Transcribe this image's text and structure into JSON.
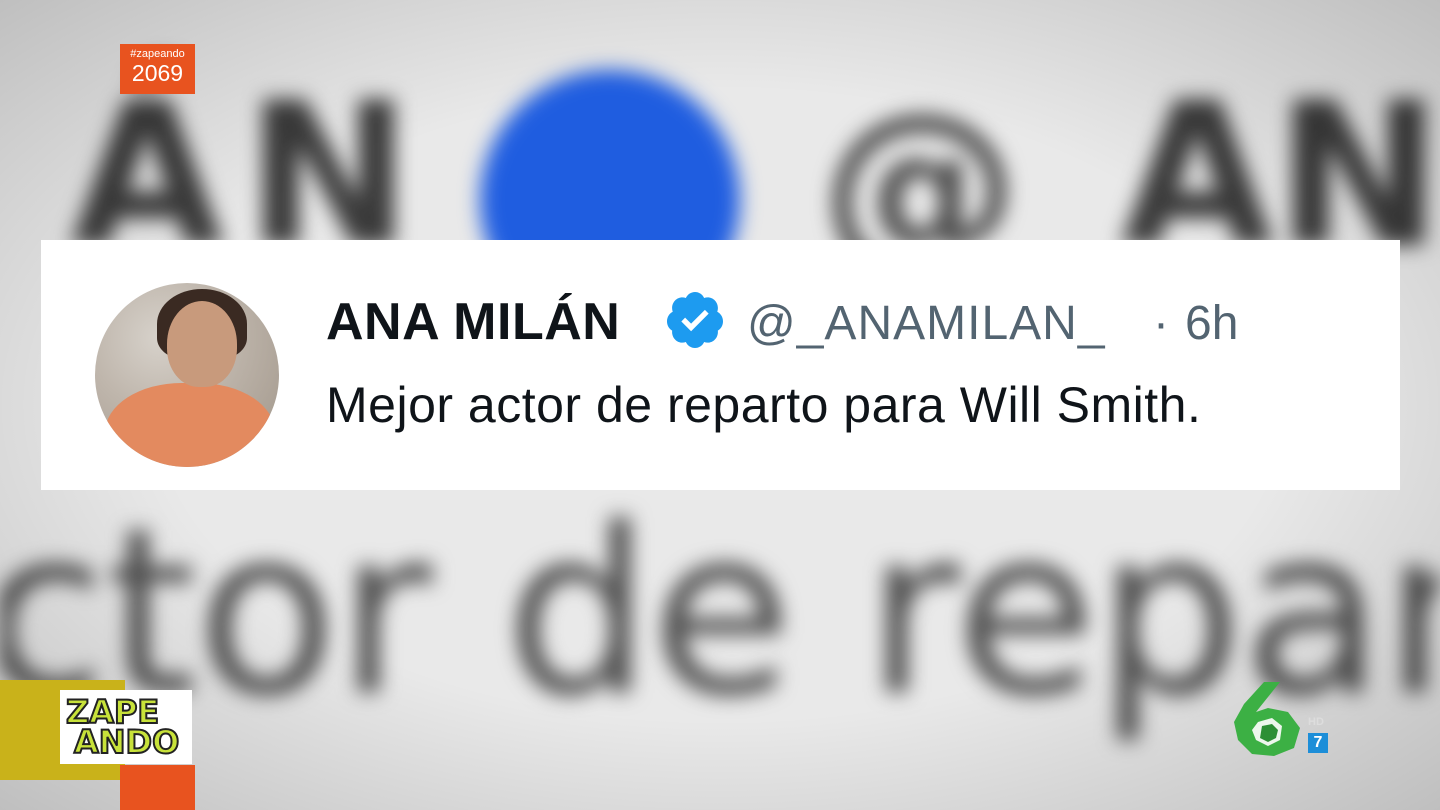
{
  "background": {
    "top_text_left": "ÁN",
    "at_symbol": "@",
    "top_text_right": "AN",
    "bottom_text": "ctor de reparto"
  },
  "tweet": {
    "name": "ANA MILÁN",
    "handle": "@_ANAMILAN_",
    "separator": "·",
    "time": "6h",
    "text": "Mejor actor de reparto para Will Smith.",
    "verified_color": "#1d9bf0"
  },
  "overlay": {
    "hashtag": "#zapeando",
    "episode": "2069",
    "show_logo_line1": "ZAPE",
    "show_logo_line2": "ANDO",
    "network_hd": "HD",
    "network_channel": "7",
    "accent_orange": "#e8531f",
    "accent_yellow": "#c9b21a",
    "network_green": "#3cb044"
  }
}
